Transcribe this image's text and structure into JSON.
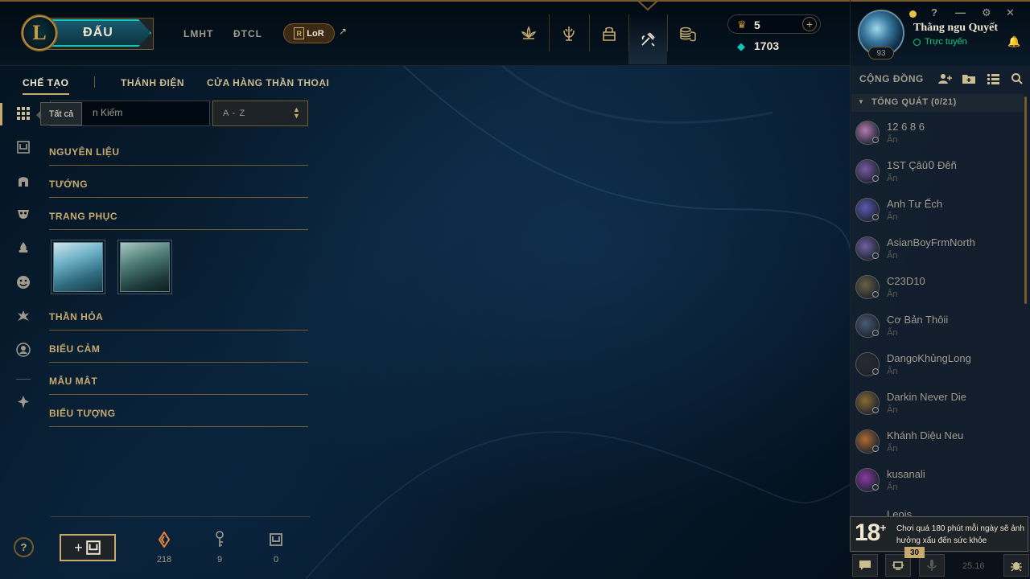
{
  "top_nav": {
    "logo": "L",
    "play_label": "ĐẤU",
    "links": [
      "LMHT",
      "ĐTCL"
    ],
    "lor_label": "LoR",
    "lor_mark": "R",
    "external_arrow": "↗",
    "icons": [
      "home-lotus-icon",
      "trophy-icon",
      "collection-bag-icon",
      "crafting-loot-icon",
      "store-coins-icon"
    ],
    "active_icon": "crafting-loot-icon"
  },
  "currency": {
    "rp_icon": "♛",
    "rp": "5",
    "plus": "+",
    "be_icon": "◆",
    "be": "1703"
  },
  "profile": {
    "level": "93",
    "name": "Thằng ngu Quyết",
    "status": "Trực tuyến",
    "window_controls": [
      "?",
      "—",
      "⚙",
      "✕"
    ]
  },
  "sub_nav": {
    "items": [
      "CHẾ TẠO",
      "THÁNH ĐIỆN",
      "CỬA HÀNG THẦN THOẠI"
    ],
    "active": "CHẾ TẠO"
  },
  "loot": {
    "tooltip": "Tất cả",
    "search_placeholder": "n Kiếm",
    "sort_value": "A - Z",
    "categories": [
      "NGUYÊN LIỆU",
      "TƯỚNG",
      "TRANG PHỤC",
      "THẦN HỎA",
      "BIỂU CẢM",
      "MẪU MẮT",
      "BIỂU TƯỢNG"
    ],
    "skin_items": [
      "skin-shard-1",
      "skin-shard-2"
    ]
  },
  "inventory": {
    "help": "?",
    "craft_plus": "+",
    "orange_essence": "218",
    "keys": "9",
    "chests": "0"
  },
  "social": {
    "title": "CỘNG ĐỒNG",
    "group_label": "TỔNG QUÁT (0/21)",
    "friends": [
      {
        "name": "12 6 8 6",
        "status": "Ẩn"
      },
      {
        "name": "1ST Çâû߀ Ðêñ",
        "status": "Ẩn"
      },
      {
        "name": "Anh Tư Ếch",
        "status": "Ẩn"
      },
      {
        "name": "AsianBoyFrmNorth",
        "status": "Ẩn"
      },
      {
        "name": "C23D10",
        "status": "Ẩn"
      },
      {
        "name": "Cơ Bản Thôii",
        "status": "Ẩn"
      },
      {
        "name": "DangoKhủngLong",
        "status": "Ẩn"
      },
      {
        "name": "Darkin Never Die",
        "status": "Ẩn"
      },
      {
        "name": "Khánh Diệu Neu",
        "status": "Ẩn"
      },
      {
        "name": "kusanali",
        "status": "Ẩn"
      }
    ],
    "partial_friend": "Leois",
    "warning_age": "18",
    "warning_plus": "+",
    "warning_text": "Chơi quá 180 phút mỗi ngày sẽ ảnh hưởng xấu đến sức khỏe",
    "badge": "30",
    "version": "25.16"
  },
  "colors": {
    "gold": "#c8aa6e",
    "teal": "#0ac8b9",
    "online": "#0acf83",
    "background": "#010a13"
  }
}
